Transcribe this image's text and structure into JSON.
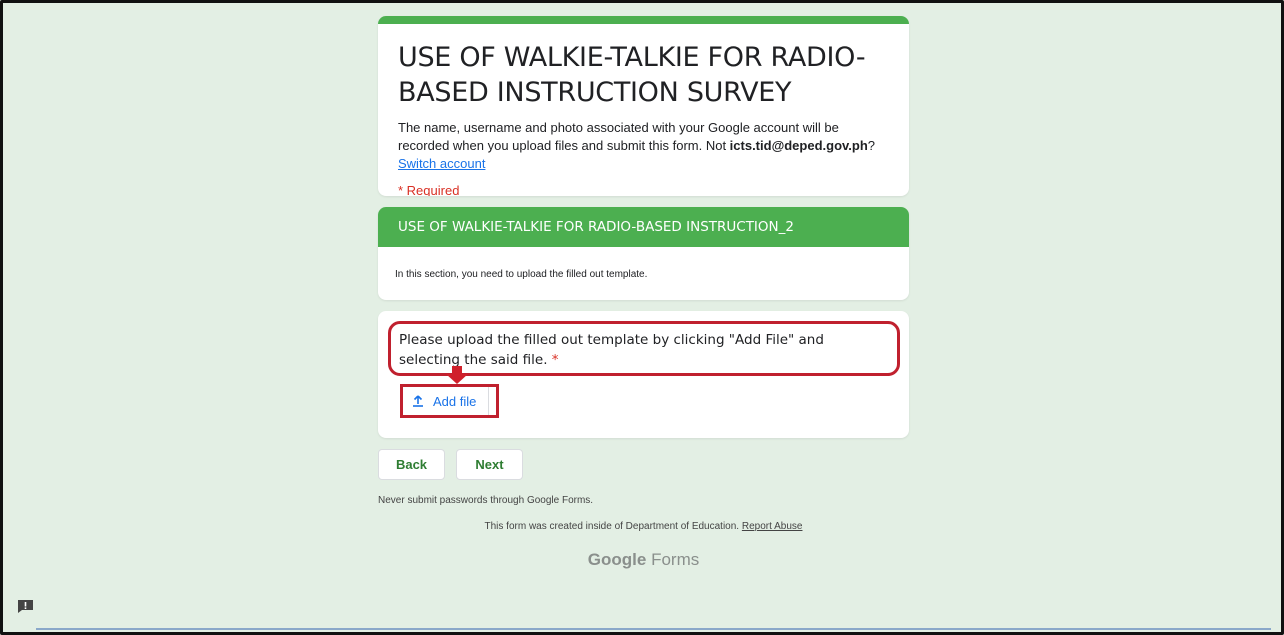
{
  "form": {
    "title": "USE OF WALKIE-TALKIE FOR RADIO-BASED INSTRUCTION SURVEY",
    "description_prefix": "The name, username and photo associated with your Google account will be recorded when you upload files and submit this form. Not ",
    "account_email": "icts.tid@deped.gov.ph",
    "description_suffix": "? ",
    "switch_account_link": "Switch account",
    "required_note": "* Required"
  },
  "section": {
    "title": "USE OF WALKIE-TALKIE FOR RADIO-BASED INSTRUCTION_2",
    "description": "In this section, you need to upload the filled out template."
  },
  "question": {
    "text": "Please upload the filled out template by clicking \"Add File\" and selecting the said file.",
    "required_marker": "*",
    "add_file_label": "Add file"
  },
  "navigation": {
    "back_label": "Back",
    "next_label": "Next"
  },
  "footer": {
    "password_warning": "Never submit passwords through Google Forms.",
    "created_text": "This form was created inside of Department of Education.",
    "report_abuse_link": "Report Abuse",
    "brand_google": "Google",
    "brand_forms": "Forms"
  },
  "colors": {
    "accent_green": "#4caf50",
    "background": "#e3efe4",
    "highlight_red": "#c0202e",
    "link_blue": "#1a73e8",
    "required_red": "#d93025"
  },
  "icons": {
    "upload": "upload-icon",
    "feedback": "feedback-icon"
  }
}
